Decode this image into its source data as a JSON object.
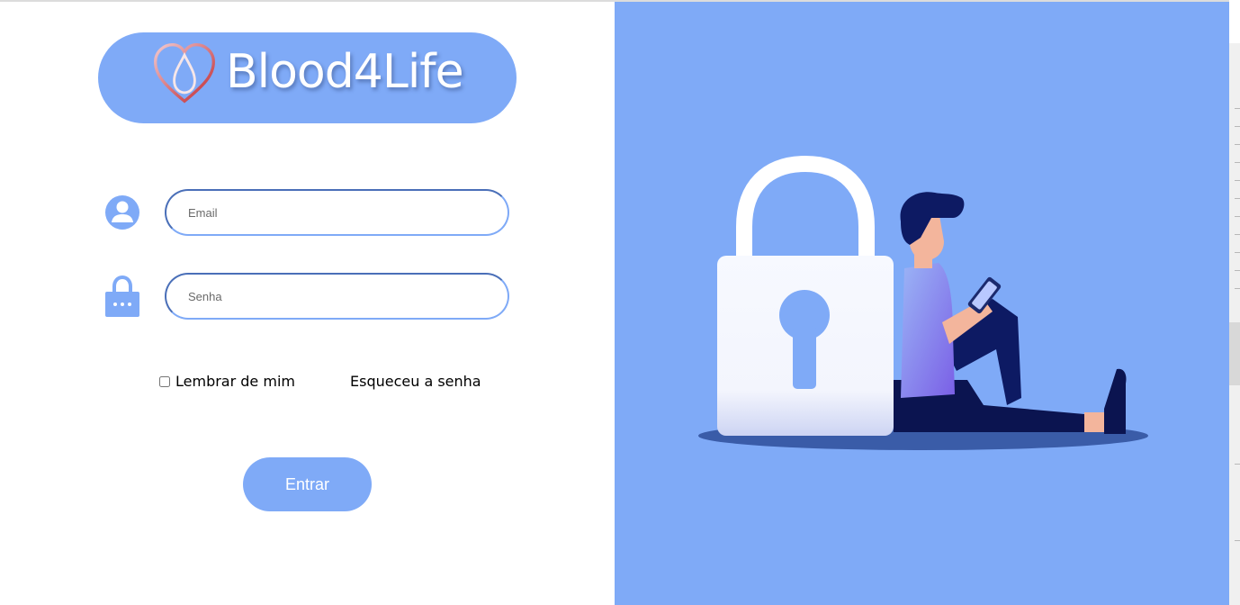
{
  "brand": {
    "name": "Blood4Life"
  },
  "form": {
    "email_placeholder": "Email",
    "password_placeholder": "Senha",
    "remember_label": "Lembrar de mim",
    "forgot_label": "Esqueceu a senha",
    "submit_label": "Entrar"
  },
  "colors": {
    "accent": "#7faaf7",
    "field_border": "#4a6fb8",
    "background": "#ffffff"
  },
  "icons": [
    "heart-drop-logo-icon",
    "user-icon",
    "lock-icon",
    "padlock-illustration",
    "person-reading-illustration"
  ]
}
